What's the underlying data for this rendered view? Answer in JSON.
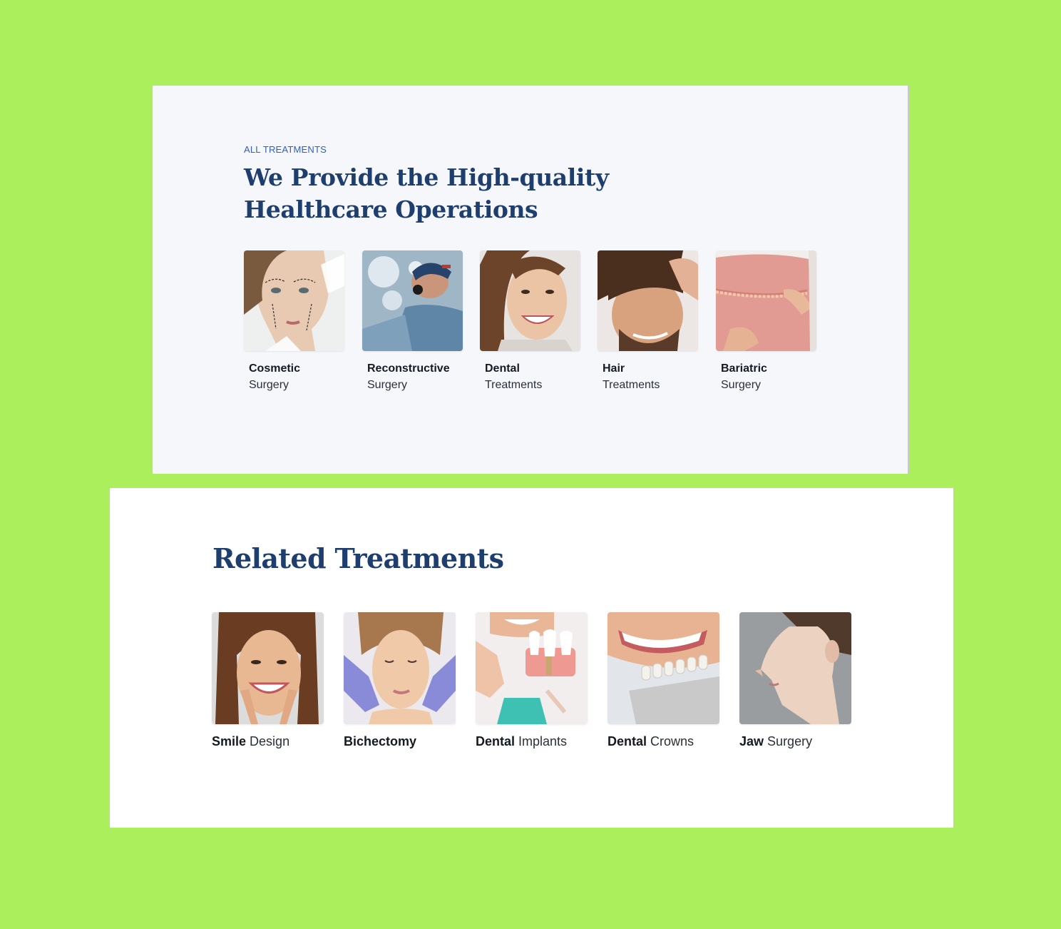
{
  "treatments_section": {
    "eyebrow": "ALL TREATMENTS",
    "heading_line1": "We Provide the High-quality",
    "heading_line2": "Healthcare Operations",
    "cards": [
      {
        "bold": "Cosmetic",
        "light": "Surgery",
        "image": "woman-face-surgery-marks"
      },
      {
        "bold": "Reconstructive",
        "light": "Surgery",
        "image": "surgeons-operating"
      },
      {
        "bold": "Dental",
        "light": "Treatments",
        "image": "smiling-woman"
      },
      {
        "bold": "Hair",
        "light": "Treatments",
        "image": "man-touching-hair"
      },
      {
        "bold": "Bariatric",
        "light": "Surgery",
        "image": "waist-measuring-tape"
      }
    ]
  },
  "related_section": {
    "heading": "Related Treatments",
    "cards": [
      {
        "bold": "Smile",
        "light": "Design",
        "image": "woman-smiling-fingers"
      },
      {
        "bold": "Bichectomy",
        "light": "",
        "image": "face-massage-gloves"
      },
      {
        "bold": "Dental",
        "light": "Implants",
        "image": "dental-implant-model"
      },
      {
        "bold": "Dental",
        "light": "Crowns",
        "image": "teeth-shade-guide"
      },
      {
        "bold": "Jaw",
        "light": "Surgery",
        "image": "woman-profile-jawline"
      }
    ]
  },
  "colors": {
    "background": "#acef5c",
    "heading": "#1e3f6e",
    "eyebrow": "#2f5fb8"
  }
}
